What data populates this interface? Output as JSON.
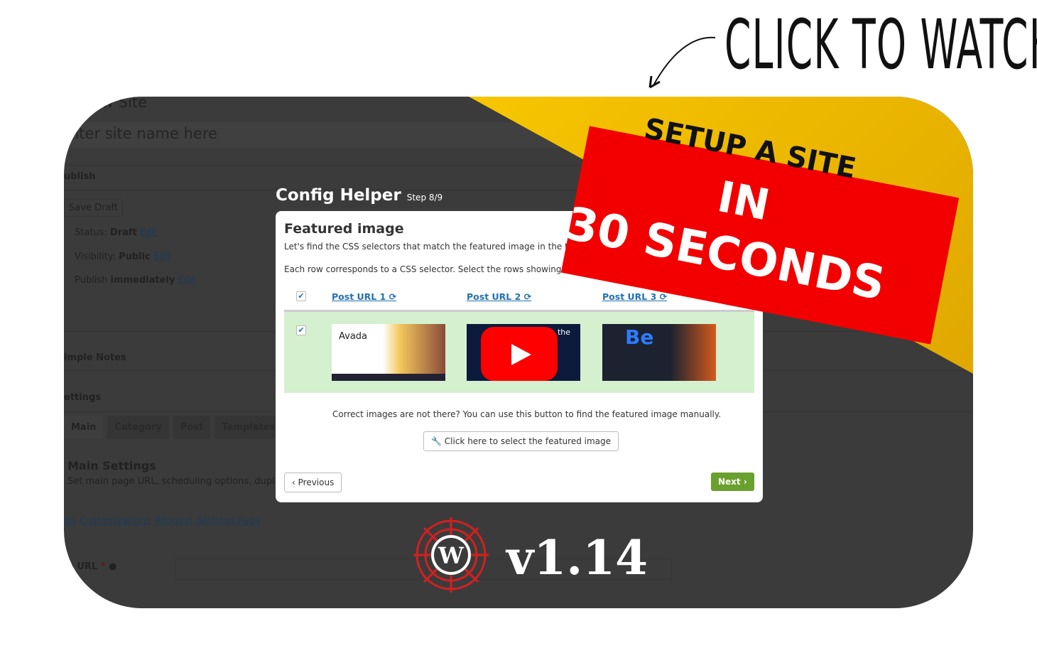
{
  "overlay": {
    "cta": "CLICK TO WATCH",
    "banner_line1": "SETUP A SITE",
    "banner_line2": "IN",
    "banner_line3": "30 SECONDS",
    "version": "v1.14",
    "colors": {
      "banner": "#f20000",
      "triangle": "#f7c600",
      "bg": "#3b3b3b"
    }
  },
  "background": {
    "page_title": "ew Site",
    "title_placeholder": "nter site name here",
    "publish": {
      "heading": "ublish",
      "save_draft": "Save Draft",
      "status_label": "Status:",
      "status_value": "Draft",
      "visibility_label": "Visibility:",
      "visibility_value": "Public",
      "publish_label": "Publish",
      "publish_value": "immediately",
      "edit": "Edit"
    },
    "notes_heading": "imple Notes",
    "settings_heading": "ettings",
    "tabs": [
      "Main",
      "Category",
      "Post",
      "Templates"
    ],
    "main_settings_title": "Main Settings",
    "main_settings_desc": "Set main page URL, scheduling options, duplicate p",
    "links": [
      "op",
      "Customizations",
      "Request",
      "Settings Page"
    ],
    "url_label": "e URL",
    "required": "*"
  },
  "modal": {
    "title": "Config Helper",
    "step": "Step 8/9",
    "heading": "Featured image",
    "desc1": "Let's find the CSS selectors that match the featured image in the ta",
    "desc2": "Each row corresponds to a CSS selector. Select the rows showing the correct featu",
    "columns": [
      "Post URL 1",
      "Post URL 2",
      "Post URL 3"
    ],
    "thumbs": {
      "t1": "Avada",
      "t2": "the",
      "t3": "Be"
    },
    "hint": "Correct images are not there? You can use this button to find the featured image manually.",
    "select_button": "Click here to select the featured image",
    "previous": "Previous",
    "next": "Next"
  }
}
